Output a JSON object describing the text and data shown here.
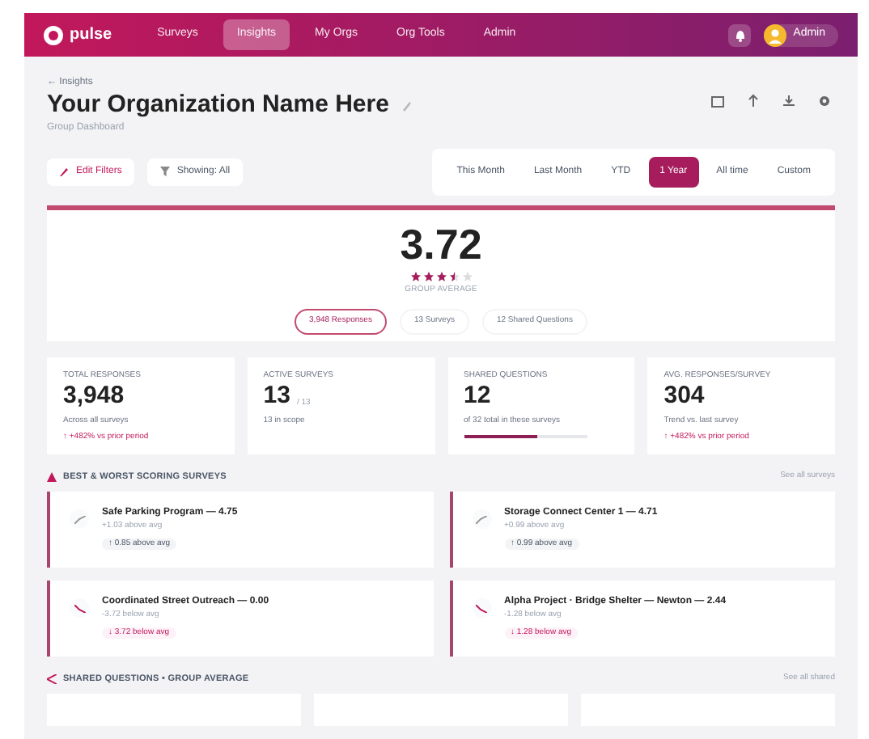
{
  "app": {
    "logo": "pulse",
    "nav": [
      {
        "label": "Surveys",
        "selected": false
      },
      {
        "label": "Insights",
        "selected": true
      },
      {
        "label": "My Orgs",
        "selected": false
      },
      {
        "label": "Org Tools",
        "selected": false
      },
      {
        "label": "Admin",
        "selected": false
      }
    ],
    "user": "Admin"
  },
  "header": {
    "breadcrumb": "← Insights",
    "title": "Your Organization Name Here",
    "subtitle": "Group Dashboard"
  },
  "toolbar": {
    "buttons": [
      "Edit Filters",
      "Showing: All"
    ],
    "periods": [
      {
        "label": "This Month",
        "selected": false
      },
      {
        "label": "Last Month",
        "selected": false
      },
      {
        "label": "YTD",
        "selected": false
      },
      {
        "label": "1 Year",
        "selected": true
      },
      {
        "label": "All time",
        "selected": false
      },
      {
        "label": "Custom",
        "selected": false
      }
    ]
  },
  "score": {
    "value": "3.72",
    "stars": 3.5,
    "caption": "GROUP AVERAGE",
    "chips": [
      {
        "label": "3,948 Responses",
        "selected": true
      },
      {
        "label": "13 Surveys",
        "selected": false
      },
      {
        "label": "12 Shared Questions",
        "selected": false
      }
    ]
  },
  "stats": [
    {
      "label": "TOTAL RESPONSES",
      "value": "3,948",
      "note": "Across all surveys",
      "delta": "↑ +482% vs prior period"
    },
    {
      "label": "ACTIVE SURVEYS",
      "value": "13",
      "unit": "/ 13",
      "note": "13 in scope"
    },
    {
      "label": "SHARED QUESTIONS",
      "value": "12",
      "note": "of 32 total in these surveys",
      "level": 0.6
    },
    {
      "label": "AVG. RESPONSES/SURVEY",
      "value": "304",
      "note": "Trend vs. last survey",
      "delta": "↑ +482% vs prior period"
    }
  ],
  "best_worst": {
    "title": "BEST & WORST SCORING SURVEYS",
    "action": "See all surveys",
    "surveys": [
      {
        "name": "Safe Parking Program — 4.75",
        "note": "+1.03 above avg",
        "badge": "↑ 0.85 above avg",
        "kind": "up"
      },
      {
        "name": "Storage Connect Center 1 — 4.71",
        "note": "+0.99 above avg",
        "badge": "↑ 0.99 above avg",
        "kind": "up"
      },
      {
        "name": "Coordinated Street Outreach — 0.00",
        "note": "-3.72 below avg",
        "badge": "↓ 3.72 below avg",
        "kind": "down"
      },
      {
        "name": "Alpha Project · Bridge Shelter — Newton — 2.44",
        "note": "-1.28 below avg",
        "badge": "↓ 1.28 below avg",
        "kind": "down"
      }
    ]
  },
  "shared": {
    "title": "SHARED QUESTIONS • GROUP AVERAGE",
    "action": "See all shared"
  }
}
